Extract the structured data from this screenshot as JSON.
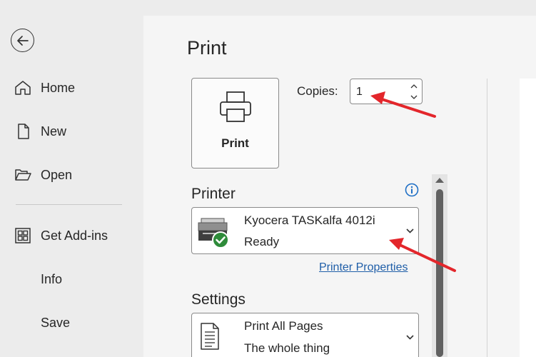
{
  "nav": {
    "back_icon": "back-arrow-icon",
    "items": [
      {
        "label": "Home",
        "icon": "home-icon"
      },
      {
        "label": "New",
        "icon": "document-icon"
      },
      {
        "label": "Open",
        "icon": "folder-open-icon"
      },
      {
        "label": "Get Add-ins",
        "icon": "grid-icon"
      },
      {
        "label": "Info",
        "icon": ""
      },
      {
        "label": "Save",
        "icon": ""
      }
    ]
  },
  "main": {
    "title": "Print",
    "print_button": {
      "label": "Print",
      "icon": "printer-icon"
    },
    "copies": {
      "label": "Copies:",
      "value": "1"
    },
    "printer": {
      "section_title": "Printer",
      "name": "Kyocera TASKalfa 4012i",
      "status": "Ready",
      "properties_link": "Printer Properties",
      "info_icon": "info-icon"
    },
    "settings": {
      "section_title": "Settings",
      "option_primary": "Print All Pages",
      "option_secondary": "The whole thing"
    }
  },
  "colors": {
    "link": "#1f5ea8",
    "annotation_arrow": "#e3262b",
    "status_ok": "#2e8b3a",
    "info": "#1f6fc5"
  }
}
